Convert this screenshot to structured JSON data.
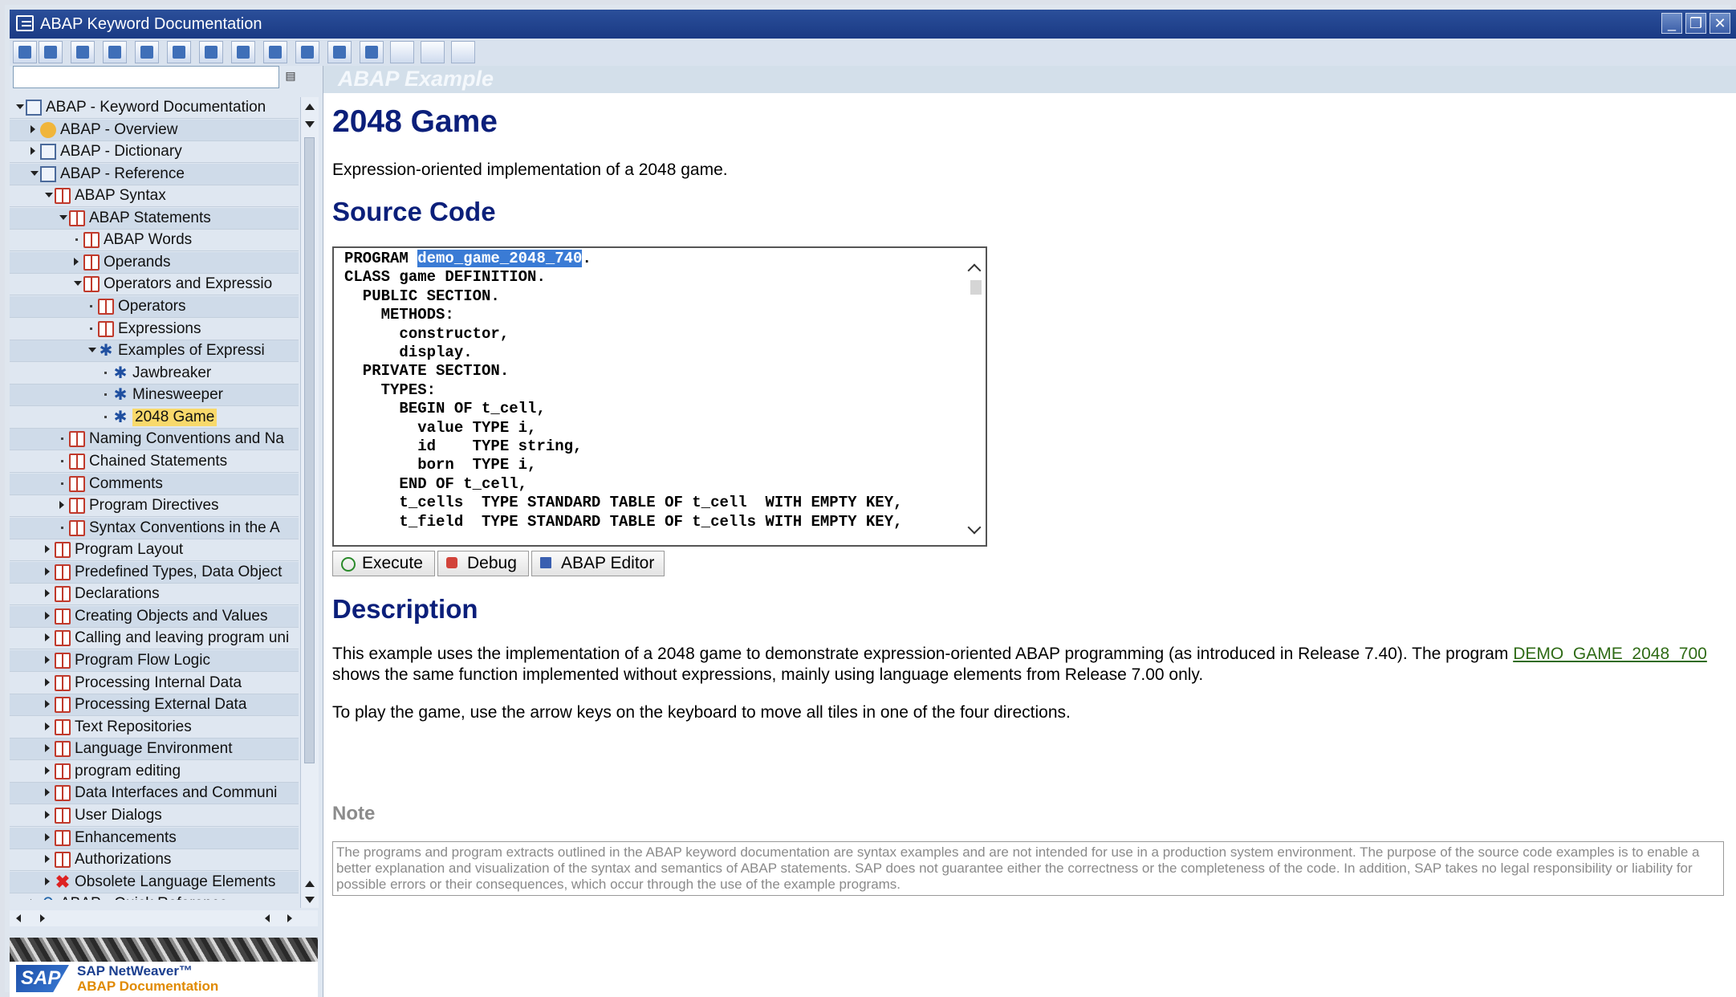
{
  "window": {
    "title": "ABAP Keyword Documentation"
  },
  "toolbar": {
    "buttons": [
      "info-icon",
      "structure-icon",
      "expand-icon",
      "collapse-icon",
      "print-icon",
      "print-preview-icon",
      "export-icon",
      "help-icon",
      "favorites-icon",
      "settings-icon",
      "gear-icon",
      "layout-icon",
      "up-icon",
      "back-icon",
      "forward-icon"
    ]
  },
  "search": {
    "value": "",
    "placeholder": ""
  },
  "tree": {
    "items": [
      {
        "label": "ABAP - Keyword Documentation",
        "level": 0,
        "state": "open",
        "icon": "doc"
      },
      {
        "label": "ABAP - Overview",
        "level": 1,
        "state": "closed",
        "icon": "people"
      },
      {
        "label": "ABAP - Dictionary",
        "level": 1,
        "state": "closed",
        "icon": "doc"
      },
      {
        "label": "ABAP - Reference",
        "level": 1,
        "state": "open",
        "icon": "doc"
      },
      {
        "label": "ABAP Syntax",
        "level": 2,
        "state": "open",
        "icon": "book"
      },
      {
        "label": "ABAP Statements",
        "level": 3,
        "state": "open",
        "icon": "book"
      },
      {
        "label": "ABAP Words",
        "level": 4,
        "state": "leaf",
        "icon": "book"
      },
      {
        "label": "Operands",
        "level": 4,
        "state": "closed",
        "icon": "book"
      },
      {
        "label": "Operators and Expressio",
        "level": 4,
        "state": "open",
        "icon": "book"
      },
      {
        "label": "Operators",
        "level": 5,
        "state": "leaf",
        "icon": "book"
      },
      {
        "label": "Expressions",
        "level": 5,
        "state": "leaf",
        "icon": "book"
      },
      {
        "label": "Examples of Expressi",
        "level": 5,
        "state": "open",
        "icon": "gear"
      },
      {
        "label": "Jawbreaker",
        "level": 6,
        "state": "leaf",
        "icon": "gear"
      },
      {
        "label": "Minesweeper",
        "level": 6,
        "state": "leaf",
        "icon": "gear"
      },
      {
        "label": "2048 Game",
        "level": 6,
        "state": "leaf",
        "icon": "gear",
        "selected": true
      },
      {
        "label": "Naming Conventions and Na",
        "level": 3,
        "state": "leaf",
        "icon": "book"
      },
      {
        "label": "Chained Statements",
        "level": 3,
        "state": "leaf",
        "icon": "book"
      },
      {
        "label": "Comments",
        "level": 3,
        "state": "leaf",
        "icon": "book"
      },
      {
        "label": "Program Directives",
        "level": 3,
        "state": "closed",
        "icon": "book"
      },
      {
        "label": "Syntax Conventions in the A",
        "level": 3,
        "state": "leaf",
        "icon": "book"
      },
      {
        "label": "Program Layout",
        "level": 2,
        "state": "closed",
        "icon": "book"
      },
      {
        "label": "Predefined Types, Data Object",
        "level": 2,
        "state": "closed",
        "icon": "book"
      },
      {
        "label": "Declarations",
        "level": 2,
        "state": "closed",
        "icon": "book"
      },
      {
        "label": "Creating Objects and Values",
        "level": 2,
        "state": "closed",
        "icon": "book"
      },
      {
        "label": "Calling and leaving program uni",
        "level": 2,
        "state": "closed",
        "icon": "book"
      },
      {
        "label": "Program Flow Logic",
        "level": 2,
        "state": "closed",
        "icon": "book"
      },
      {
        "label": "Processing Internal Data",
        "level": 2,
        "state": "closed",
        "icon": "book"
      },
      {
        "label": "Processing External Data",
        "level": 2,
        "state": "closed",
        "icon": "book"
      },
      {
        "label": "Text Repositories",
        "level": 2,
        "state": "closed",
        "icon": "book"
      },
      {
        "label": "Language Environment",
        "level": 2,
        "state": "closed",
        "icon": "book"
      },
      {
        "label": "program editing",
        "level": 2,
        "state": "closed",
        "icon": "book"
      },
      {
        "label": "Data Interfaces and Communi",
        "level": 2,
        "state": "closed",
        "icon": "book"
      },
      {
        "label": "User Dialogs",
        "level": 2,
        "state": "closed",
        "icon": "book"
      },
      {
        "label": "Enhancements",
        "level": 2,
        "state": "closed",
        "icon": "book"
      },
      {
        "label": "Authorizations",
        "level": 2,
        "state": "closed",
        "icon": "book"
      },
      {
        "label": "Obsolete Language Elements",
        "level": 2,
        "state": "closed",
        "icon": "cross"
      },
      {
        "label": "ABAP - Quick Reference",
        "level": 1,
        "state": "closed",
        "icon": "quick"
      }
    ]
  },
  "brand": {
    "line1": "SAP NetWeaver™",
    "line2": "ABAP Documentation",
    "logo": "SAP"
  },
  "content": {
    "header": "ABAP Example",
    "title": "2048 Game",
    "intro": "Expression-oriented implementation of a 2048 game.",
    "source_heading": "Source Code",
    "code": {
      "first_prefix": "PROGRAM ",
      "first_highlight": "demo_game_2048_740",
      "first_suffix": ".",
      "body": "\nCLASS game DEFINITION.\n  PUBLIC SECTION.\n    METHODS:\n      constructor,\n      display.\n  PRIVATE SECTION.\n    TYPES:\n      BEGIN OF t_cell,\n        value TYPE i,\n        id    TYPE string,\n        born  TYPE i,\n      END OF t_cell,\n      t_cells  TYPE STANDARD TABLE OF t_cell  WITH EMPTY KEY,\n      t_field  TYPE STANDARD TABLE OF t_cells WITH EMPTY KEY,"
    },
    "buttons": {
      "execute": "Execute",
      "debug": "Debug",
      "editor": "ABAP Editor"
    },
    "description_heading": "Description",
    "description_p1_before": "This example uses the implementation of a 2048 game to demonstrate expression-oriented ABAP programming (as introduced in Release 7.40). The program ",
    "description_link": "DEMO_GAME_2048_700",
    "description_p1_after": " shows the same function implemented without expressions, mainly using language elements from Release 7.00 only.",
    "description_p2": "To play the game, use the arrow keys on the keyboard to move all tiles in one of the four directions.",
    "note_heading": "Note",
    "note_text": "The programs and program extracts outlined in the ABAP keyword documentation are syntax examples and are not intended for use in a production system environment. The purpose of the source code examples is to enable a better explanation and visualization of the syntax and semantics of ABAP statements. SAP does not guarantee either the correctness or the completeness of the code. In addition, SAP takes no legal responsibility or liability for possible errors or their consequences, which occur through the use of the example programs."
  }
}
